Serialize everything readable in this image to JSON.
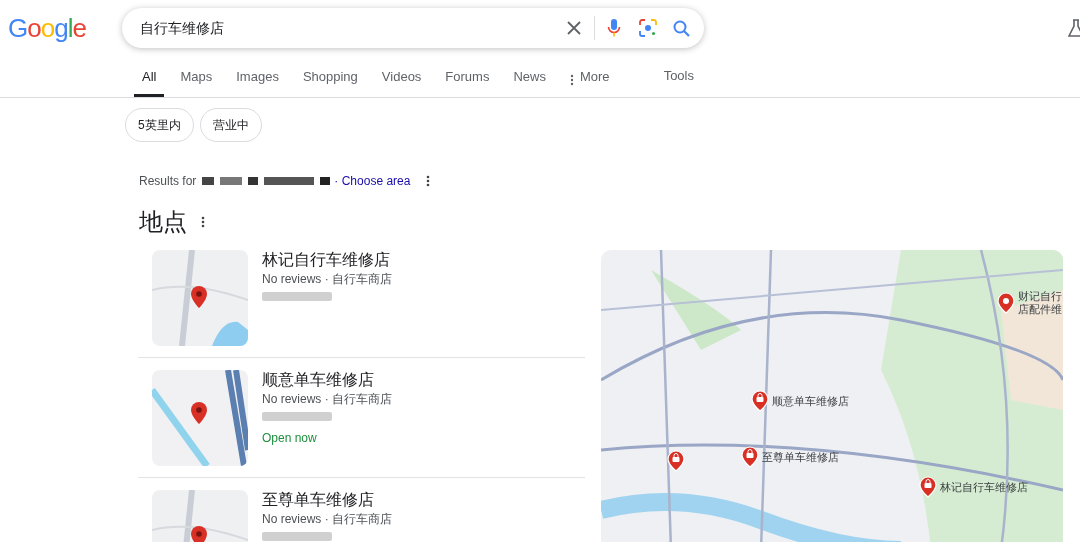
{
  "logo": "Google",
  "search": {
    "value": "自行车维修店"
  },
  "tabs": [
    {
      "label": "All",
      "selected": true
    },
    {
      "label": "Maps",
      "selected": false
    },
    {
      "label": "Images",
      "selected": false
    },
    {
      "label": "Shopping",
      "selected": false
    },
    {
      "label": "Videos",
      "selected": false
    },
    {
      "label": "Forums",
      "selected": false
    },
    {
      "label": "News",
      "selected": false
    },
    {
      "label": "More",
      "selected": false,
      "kind": "menu"
    }
  ],
  "tools": "Tools",
  "chips": [
    "5英里内",
    "营业中"
  ],
  "results_for": {
    "prefix": "Results for",
    "link": "· Choose area"
  },
  "places": {
    "title": "地点",
    "items": [
      {
        "name": "林记自行车维修店",
        "meta": "No reviews · 自行车商店",
        "kind": "lake"
      },
      {
        "name": "顺意单车维修店",
        "meta": "No reviews · 自行车商店",
        "status": "Open now",
        "kind": "river"
      },
      {
        "name": "至尊单车维修店",
        "meta": "No reviews · 自行车商店",
        "kind": "lake"
      }
    ]
  },
  "map": {
    "pins": [
      {
        "kind": "place",
        "label_lines": [
          "财记自行",
          "店配件维"
        ]
      },
      {
        "kind": "shop",
        "label_lines": [
          "顺意单车维修店"
        ]
      },
      {
        "kind": "shop"
      },
      {
        "kind": "shop",
        "label_lines": [
          "至尊单车维修店"
        ]
      },
      {
        "kind": "shop",
        "label_lines": [
          "林记自行车维修店"
        ]
      }
    ]
  }
}
